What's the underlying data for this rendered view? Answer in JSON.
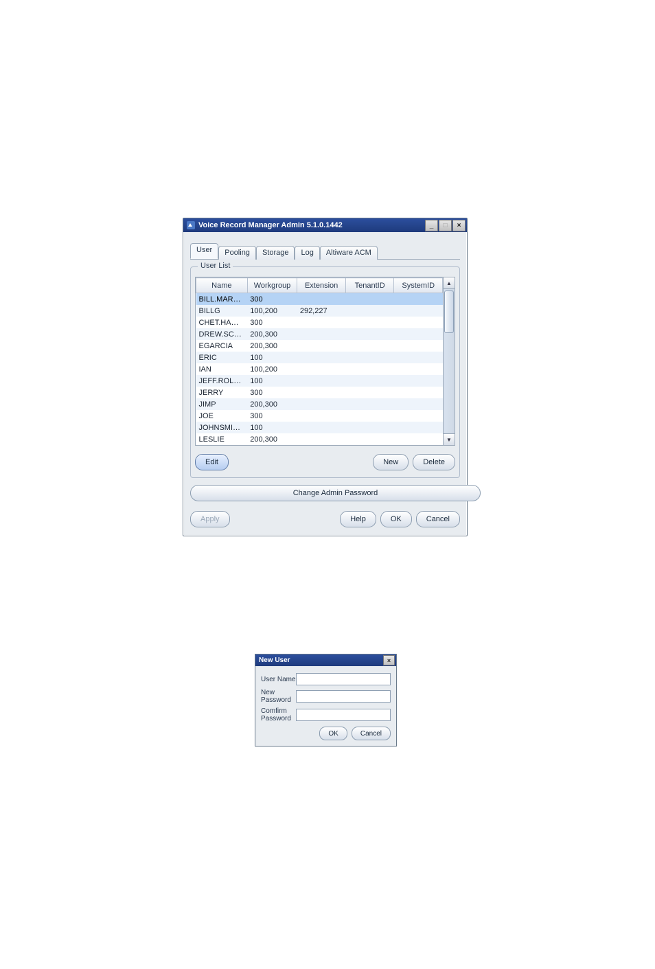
{
  "window": {
    "title": "Voice Record Manager Admin 5.1.0.1442",
    "controls": {
      "minimize_glyph": "_",
      "maximize_glyph": "□",
      "close_glyph": "×"
    }
  },
  "tabs": [
    {
      "label": "User",
      "active": true
    },
    {
      "label": "Pooling",
      "active": false
    },
    {
      "label": "Storage",
      "active": false
    },
    {
      "label": "Log",
      "active": false
    },
    {
      "label": "Altiware ACM",
      "active": false
    }
  ],
  "user_list": {
    "legend": "User List",
    "columns": [
      "Name",
      "Workgroup",
      "Extension",
      "TenantID",
      "SystemID"
    ],
    "rows": [
      {
        "name": "BILL.MAR…",
        "workgroup": "300",
        "extension": "",
        "tenant": "",
        "system": "",
        "selected": true
      },
      {
        "name": "BILLG",
        "workgroup": "100,200",
        "extension": "292,227",
        "tenant": "",
        "system": "",
        "selected": false
      },
      {
        "name": "CHET.HA…",
        "workgroup": "300",
        "extension": "",
        "tenant": "",
        "system": "",
        "selected": false
      },
      {
        "name": "DREW.SC…",
        "workgroup": "200,300",
        "extension": "",
        "tenant": "",
        "system": "",
        "selected": false
      },
      {
        "name": "EGARCIA",
        "workgroup": "200,300",
        "extension": "",
        "tenant": "",
        "system": "",
        "selected": false
      },
      {
        "name": "ERIC",
        "workgroup": "100",
        "extension": "",
        "tenant": "",
        "system": "",
        "selected": false
      },
      {
        "name": "IAN",
        "workgroup": "100,200",
        "extension": "",
        "tenant": "",
        "system": "",
        "selected": false
      },
      {
        "name": "JEFF.ROL…",
        "workgroup": "100",
        "extension": "",
        "tenant": "",
        "system": "",
        "selected": false
      },
      {
        "name": "JERRY",
        "workgroup": "300",
        "extension": "",
        "tenant": "",
        "system": "",
        "selected": false
      },
      {
        "name": "JIMP",
        "workgroup": "200,300",
        "extension": "",
        "tenant": "",
        "system": "",
        "selected": false
      },
      {
        "name": "JOE",
        "workgroup": "300",
        "extension": "",
        "tenant": "",
        "system": "",
        "selected": false
      },
      {
        "name": "JOHNSMI…",
        "workgroup": "100",
        "extension": "",
        "tenant": "",
        "system": "",
        "selected": false
      },
      {
        "name": "LESLIE",
        "workgroup": "200,300",
        "extension": "",
        "tenant": "",
        "system": "",
        "selected": false
      }
    ],
    "buttons": {
      "edit": "Edit",
      "new": "New",
      "delete": "Delete"
    }
  },
  "actions": {
    "change_password": "Change Admin Password",
    "apply": "Apply",
    "help": "Help",
    "ok": "OK",
    "cancel": "Cancel"
  },
  "dialog": {
    "title": "New User",
    "close_glyph": "×",
    "fields": {
      "username_label": "User Name",
      "username_value": "",
      "newpw_label": "New Password",
      "newpw_value": "",
      "confirmpw_label": "Comfirm Password",
      "confirmpw_value": ""
    },
    "buttons": {
      "ok": "OK",
      "cancel": "Cancel"
    }
  }
}
